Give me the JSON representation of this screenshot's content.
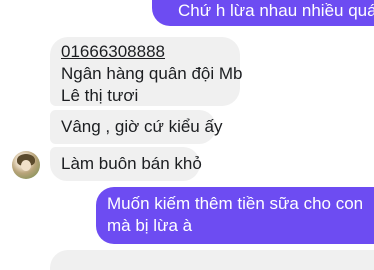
{
  "messages": [
    {
      "id": "m1",
      "side": "out",
      "text": "Chứ h lừa nhau nhiều quá"
    },
    {
      "id": "m2",
      "side": "in",
      "lines": [
        "01666308888",
        "Ngân hàng quân đội Mb",
        "Lê thị tươi"
      ]
    },
    {
      "id": "m3",
      "side": "in",
      "text": "Vâng , giờ cứ kiểu ấy"
    },
    {
      "id": "m4",
      "side": "in",
      "text": "Làm buôn bán khỏ"
    },
    {
      "id": "m5",
      "side": "out",
      "lines": [
        "Muốn kiếm thêm tiền sữa cho con",
        "mà bị lừa à"
      ]
    },
    {
      "id": "m6",
      "side": "in",
      "text": ""
    }
  ],
  "colors": {
    "outgoing_bubble": "#6d4cf2",
    "incoming_bubble": "#f0f0f0"
  },
  "contact": {
    "avatar_icon": "contact-avatar"
  }
}
